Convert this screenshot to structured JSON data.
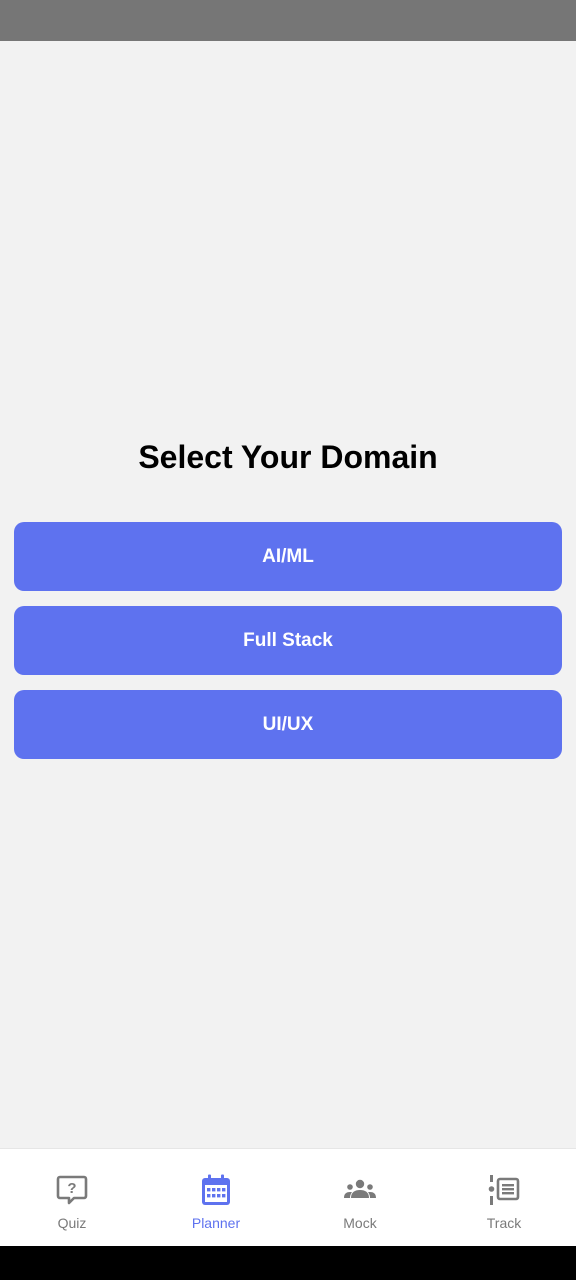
{
  "title": "Select Your Domain",
  "domains": [
    {
      "label": "AI/ML"
    },
    {
      "label": "Full Stack"
    },
    {
      "label": "UI/UX"
    }
  ],
  "colors": {
    "accent": "#5e72ef",
    "inactive": "#7a7a7a",
    "background": "#f2f2f2"
  },
  "bottom_nav": {
    "active": "Planner",
    "items": [
      {
        "label": "Quiz",
        "icon": "quiz-icon"
      },
      {
        "label": "Planner",
        "icon": "calendar-icon"
      },
      {
        "label": "Mock",
        "icon": "group-icon"
      },
      {
        "label": "Track",
        "icon": "track-list-icon"
      }
    ]
  }
}
